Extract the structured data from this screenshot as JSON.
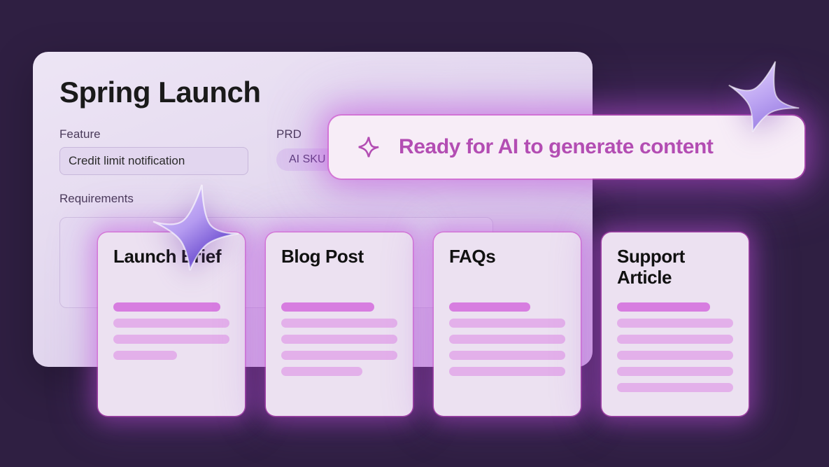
{
  "panel": {
    "title": "Spring Launch",
    "feature_label": "Feature",
    "feature_value": "Credit limit notification",
    "prd_label": "PRD",
    "prd_value": "AI SKU",
    "requirements_label": "Requirements"
  },
  "ai_bar": {
    "text": "Ready for AI to generate content"
  },
  "cards": [
    {
      "title": "Launch Brief"
    },
    {
      "title": "Blog Post"
    },
    {
      "title": "FAQs"
    },
    {
      "title": "Support Article"
    }
  ],
  "icons": {
    "sparkle_small": "sparkle-icon",
    "sparkle_glass_1": "glass-sparkle-icon",
    "sparkle_glass_2": "glass-sparkle-icon"
  },
  "colors": {
    "background": "#2f1f42",
    "panel_bg": "#ede5f5",
    "accent_pink": "#d77de0",
    "glow": "#c850dc",
    "ai_text": "#b34db3"
  }
}
